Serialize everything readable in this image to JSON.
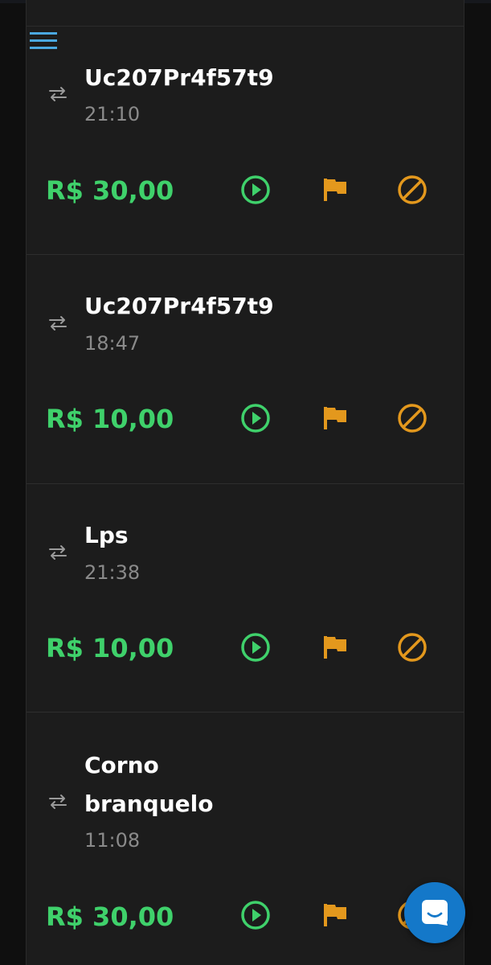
{
  "transactions": [
    {
      "name": "Uc207Pr4f57t9",
      "time": "21:10",
      "amount": "R$ 30,00"
    },
    {
      "name": "Uc207Pr4f57t9",
      "time": "18:47",
      "amount": "R$ 10,00"
    },
    {
      "name": "Lps",
      "time": "21:38",
      "amount": "R$ 10,00"
    },
    {
      "name_line1": "Corno",
      "name_line2": "branquelo",
      "time": "11:08",
      "amount": "R$ 30,00"
    }
  ],
  "icons": {
    "menu": "hamburger-menu-icon",
    "transfer": "swap-arrows-icon",
    "play": "play-circle-icon",
    "flag": "flag-icon",
    "block": "block-icon",
    "chat": "chat-icon"
  },
  "colors": {
    "background": "#1c1c1c",
    "amount": "#3fd16b",
    "play": "#3fd16b",
    "flag": "#e3981d",
    "block": "#e3981d",
    "chat_button": "#1478c9",
    "menu": "#4aa8e0"
  }
}
